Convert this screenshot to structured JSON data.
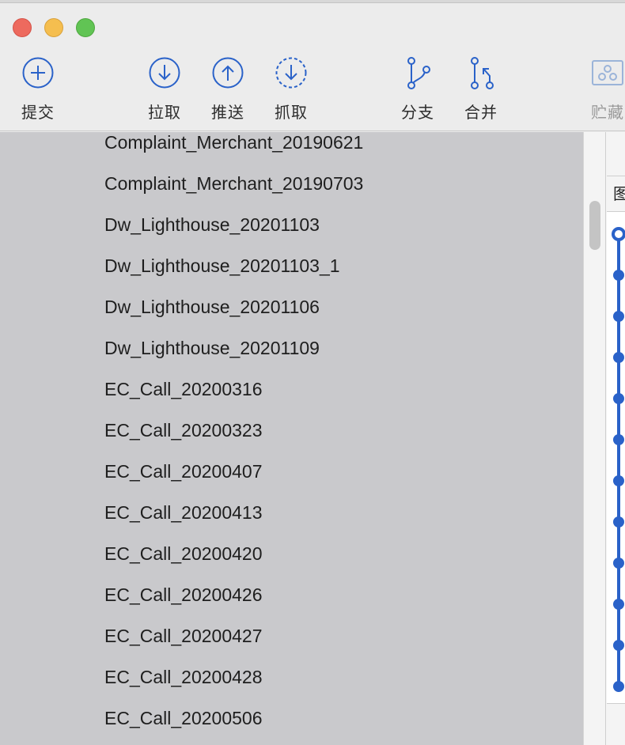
{
  "toolbar": {
    "commit_label": "提交",
    "pull_label": "拉取",
    "push_label": "推送",
    "fetch_label": "抓取",
    "branch_label": "分支",
    "merge_label": "合并",
    "stash_label": "贮藏"
  },
  "sidebar": {
    "branches": [
      "Complaint_Merchant_20190621",
      "Complaint_Merchant_20190703",
      "Dw_Lighthouse_20201103",
      "Dw_Lighthouse_20201103_1",
      "Dw_Lighthouse_20201106",
      "Dw_Lighthouse_20201109",
      "EC_Call_20200316",
      "EC_Call_20200323",
      "EC_Call_20200407",
      "EC_Call_20200413",
      "EC_Call_20200420",
      "EC_Call_20200426",
      "EC_Call_20200427",
      "EC_Call_20200428",
      "EC_Call_20200506"
    ]
  },
  "history": {
    "header_label": "图"
  },
  "colors": {
    "accent": "#2a62c9",
    "sidebar_bg": "#c9c9cc",
    "toolbar_bg": "#ececec"
  }
}
